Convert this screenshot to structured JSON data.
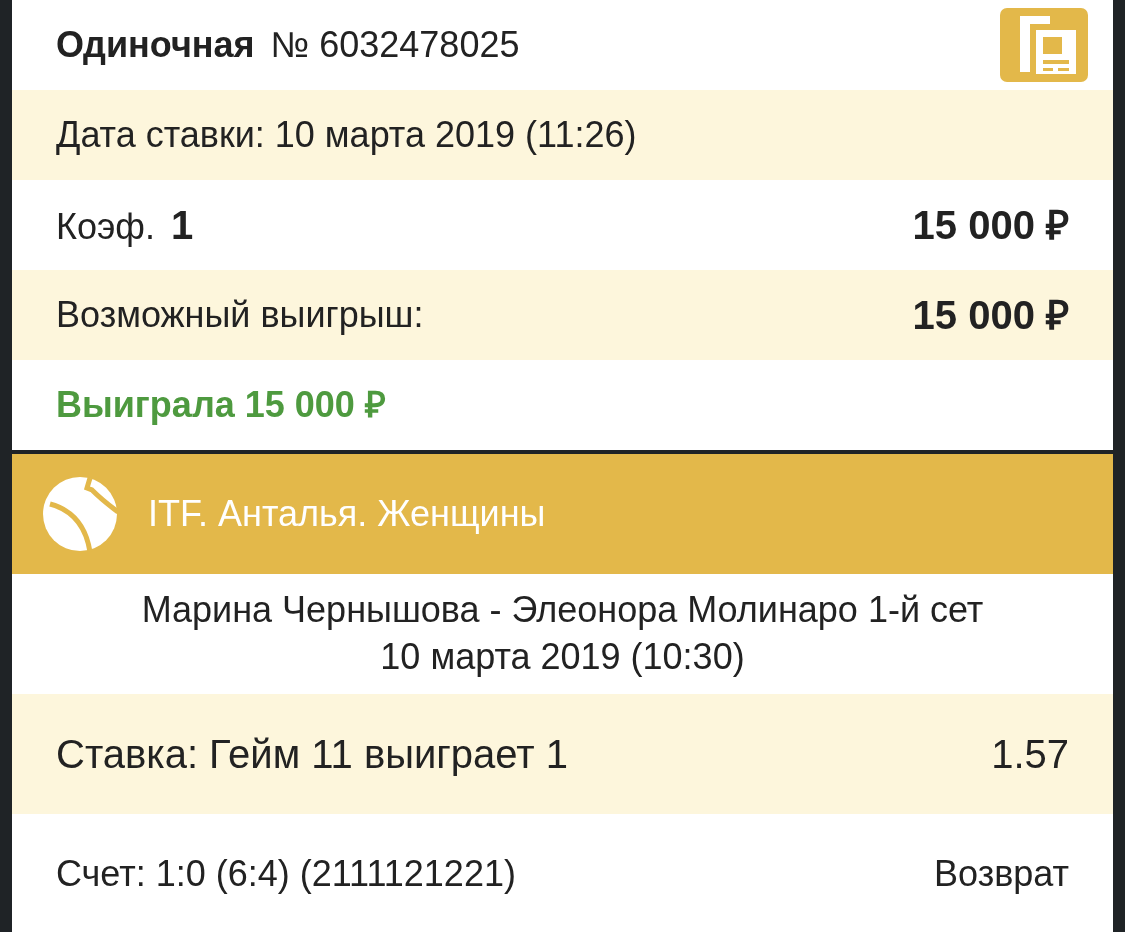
{
  "bet": {
    "type": "Одиночная",
    "number": "№ 6032478025"
  },
  "date": "Дата ставки: 10 марта 2019 (11:26)",
  "odds": {
    "label": "Коэф.",
    "value": "1",
    "stake": "15 000 ₽"
  },
  "potential_win": {
    "label": "Возможный выигрыш:",
    "value": "15 000 ₽"
  },
  "result": "Выиграла 15 000 ₽",
  "event": {
    "league": "ITF. Анталья. Женщины",
    "match": "Марина Чернышова - Элеонора Молинаро 1-й сет",
    "date": "10 марта 2019 (10:30)"
  },
  "selection": {
    "label": "Ставка: Гейм 11 выиграет 1",
    "odds": "1.57"
  },
  "score": {
    "label": "Счет: 1:0 (6:4) (2111121221)",
    "status": "Возврат"
  }
}
